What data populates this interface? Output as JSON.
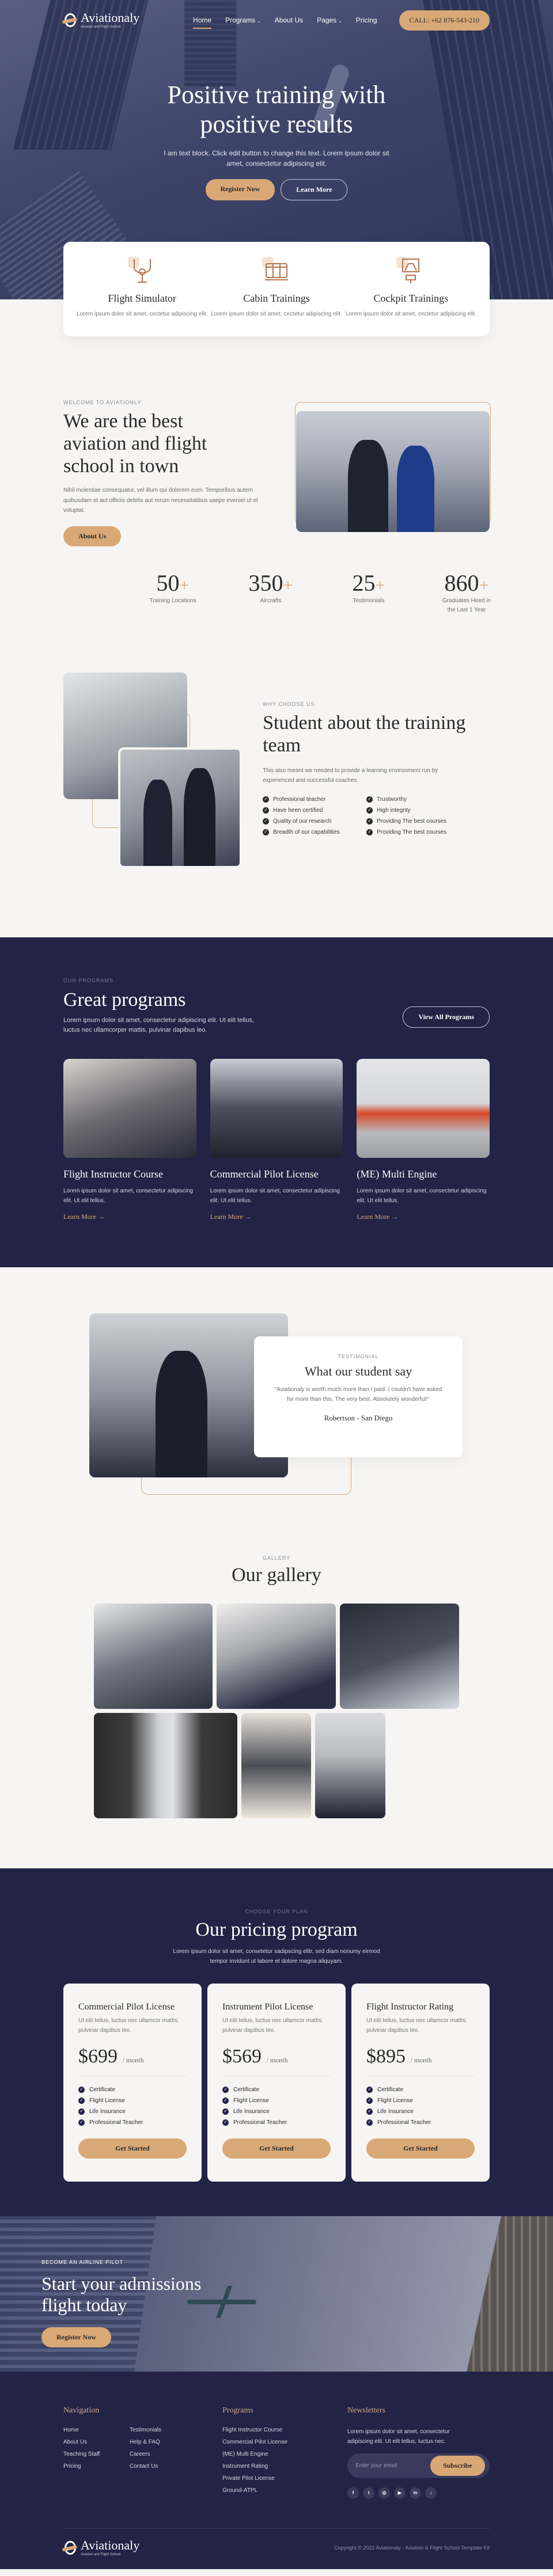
{
  "nav": {
    "brand": "Aviationaly",
    "brand_tagline": "Aviation and Flight School",
    "items": [
      {
        "label": "Home",
        "active": true
      },
      {
        "label": "Programs",
        "dropdown": true
      },
      {
        "label": "About Us"
      },
      {
        "label": "Pages",
        "dropdown": true
      },
      {
        "label": "Pricing"
      }
    ],
    "call_button": "CALL: +62 876-543-210"
  },
  "hero": {
    "title": "Positive training with positive results",
    "text": "I am text block. Click edit button to change this text. Lorem ipsum dolor sit amet, consectetur adipiscing elit.",
    "primary_button": "Register Now",
    "secondary_button": "Learn More"
  },
  "features": [
    {
      "icon": "yoke-icon",
      "title": "Flight Simulator",
      "text": "Lorem ipsum dolor sit amet, cectetur adipiscing elit."
    },
    {
      "icon": "cabin-seats-icon",
      "title": "Cabin Trainings",
      "text": "Lorem ipsum dolor sit amet, cectetur adipiscing elit."
    },
    {
      "icon": "cockpit-icon",
      "title": "Cockpit Trainings",
      "text": "Lorem ipsum dolor sit amet, cectetur adipiscing elit."
    }
  ],
  "about": {
    "eyebrow": "WELCOME TO AVIATIONLY",
    "title": "We are the best aviation and flight school in town",
    "text": "Nihil molestiae consequatur, vel illum qui dolorem eum. Temporibus autem quibusdam et aut officiis debitis aut rerum necessitatibus saepe eveniet ut et voluptat.",
    "button": "About Us"
  },
  "stats": [
    {
      "value": "50",
      "suffix": "+",
      "label": "Training Locations"
    },
    {
      "value": "350",
      "suffix": "+",
      "label": "Aircrafts"
    },
    {
      "value": "25",
      "suffix": "+",
      "label": "Testimonials"
    },
    {
      "value": "860",
      "suffix": "+",
      "label": "Graduates Hired in the Last 1 Year"
    }
  ],
  "why": {
    "eyebrow": "WHY CHOOSE US",
    "title": "Student about the training team",
    "text": "This also meant we needed to provide a learning environment run by experienced and successful coaches.",
    "checks": [
      "Professional teacher",
      "Trustworthy",
      "Have heen certified",
      "High integrity",
      "Quality of our research",
      "Providing The best courses",
      "Breadth of our capabilities",
      "Providing The best courses"
    ]
  },
  "programs": {
    "eyebrow": "OUR PROGRAMS",
    "title": "Great programs",
    "text": "Lorem ipsum dolor sit amet, consectetur adipiscing elit. Ut elit tellus, luctus nec ullamcorper mattis, pulvinar dapibus leo.",
    "button": "View All Programs",
    "cards": [
      {
        "title": "Flight Instructor Course",
        "text": "Lorem ipsum dolor sit amet, consectetur adipiscing elit. Ut elit tellus.",
        "link": "Learn More"
      },
      {
        "title": "Commercial Pilot License",
        "text": "Lorem ipsum dolor sit amet, consectetur adipiscing elit. Ut elit tellus.",
        "link": "Learn More"
      },
      {
        "title": "(ME) Multi Engine",
        "text": "Lorem ipsum dolor sit amet, consectetur adipiscing elit. Ut elit tellus.",
        "link": "Learn More"
      }
    ]
  },
  "testimonial": {
    "eyebrow": "TESTIMONIAL",
    "title": "What our student say",
    "quote": "\"Aviationaly is worth much more than I paid. I couldn't have asked for more than this. The very best. Absolutely wonderful!\"",
    "author": "Robertson - San Diego"
  },
  "gallery": {
    "eyebrow": "GALLERY",
    "title": "Our gallery"
  },
  "pricing": {
    "eyebrow": "CHOOSE YOUR PLAN",
    "title": "Our pricing program",
    "text": "Lorem ipsum dolor sit amet, consetetur sadipscing elitr, sed diam nonumy eirmod tempor invidunt ut labore et dolore magna aliquyam.",
    "plans": [
      {
        "name": "Commercial Pilot License",
        "desc": "Ut elit tellus, luctus nec ullamcor mattis, pulvinar dapibus leo.",
        "price": "$699",
        "period": "/ month",
        "features": [
          "Certificate",
          "Flight License",
          "Life Insurance",
          "Professional Teacher"
        ],
        "button": "Get Started"
      },
      {
        "name": "Instrument Pilot License",
        "desc": "Ut elit tellus, luctus nec ullamcor mattis, pulvinar dapibus leo.",
        "price": "$569",
        "period": "/ month",
        "features": [
          "Certificate",
          "Flight License",
          "Life Insurance",
          "Professional Teacher"
        ],
        "button": "Get Started"
      },
      {
        "name": "Flight Instructor Rating",
        "desc": "Ut elit tellus, luctus nec ullamcor mattis, pulvinar dapibus leo.",
        "price": "$895",
        "period": "/ month",
        "features": [
          "Certificate",
          "Flight License",
          "Life Insurance",
          "Professional Teacher"
        ],
        "button": "Get Started"
      }
    ]
  },
  "cta": {
    "eyebrow": "BECOME AN AIRLINE PILOT",
    "title": "Start your admissions flight today",
    "button": "Register Now"
  },
  "footer": {
    "nav_title": "Navigation",
    "nav_col1": [
      "Home",
      "About Us",
      "Teaching Staff",
      "Pricing"
    ],
    "nav_col2": [
      "Testimonials",
      "Help & FAQ",
      "Careers",
      "Contact Us"
    ],
    "programs_title": "Programs",
    "programs": [
      "Flight Instructor Course",
      "Commercial Pilot License",
      "(ME) Multi Engine",
      "Instrument Rating",
      "Private Pilot License",
      "Ground-ATPL"
    ],
    "news_title": "Newsletters",
    "news_text": "Lorem ipsum dolor sit amet, consectetur adipiscing elit. Ut elit tellus, luctus nec.",
    "email_placeholder": "Enter your email",
    "subscribe": "Subscribe",
    "social": [
      {
        "icon": "facebook-icon",
        "glyph": "f"
      },
      {
        "icon": "twitter-icon",
        "glyph": "t"
      },
      {
        "icon": "instagram-icon",
        "glyph": "◎"
      },
      {
        "icon": "youtube-icon",
        "glyph": "▶"
      },
      {
        "icon": "linkedin-icon",
        "glyph": "in"
      },
      {
        "icon": "tiktok-icon",
        "glyph": "♪"
      }
    ],
    "copyright": "Copyright © 2022 Aviationaly - Aviation & Flight School Template Kit"
  },
  "colors": {
    "navy": "#222345",
    "gold": "#d9a877",
    "cream": "#f6f5f3"
  }
}
